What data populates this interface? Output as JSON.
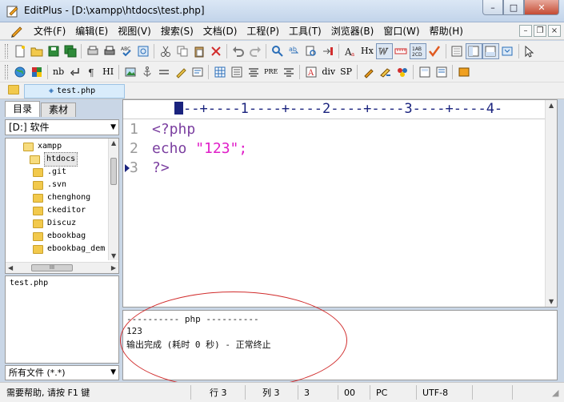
{
  "window": {
    "title": "EditPlus - [D:\\xampp\\htdocs\\test.php]",
    "buttons": {
      "minimize": "–",
      "maximize": "□",
      "close": "✕"
    }
  },
  "menu": [
    "文件(F)",
    "编辑(E)",
    "视图(V)",
    "搜索(S)",
    "文档(D)",
    "工程(P)",
    "工具(T)",
    "浏览器(B)",
    "窗口(W)",
    "帮助(H)"
  ],
  "mdi_buttons": {
    "minimize": "–",
    "restore": "❐",
    "close": "×"
  },
  "toolbar2_text": {
    "nb": "nb",
    "hi": "HI",
    "pre": "PRE",
    "div": "div",
    "sp": "SP",
    "hx": "Hx"
  },
  "file_tab": {
    "name": "test.php"
  },
  "left_panel": {
    "tabs": [
      "目录",
      "素材"
    ],
    "drive": "[D:] 软件",
    "tree": [
      {
        "name": "xampp",
        "level": 0,
        "open": true
      },
      {
        "name": "htdocs",
        "level": 1,
        "open": true,
        "selected": true
      },
      {
        "name": ".git",
        "level": 2
      },
      {
        "name": ".svn",
        "level": 2
      },
      {
        "name": "chenghong",
        "level": 2
      },
      {
        "name": "ckeditor",
        "level": 2
      },
      {
        "name": "Discuz",
        "level": 2
      },
      {
        "name": "ebookbag",
        "level": 2
      },
      {
        "name": "ebookbag_dem",
        "level": 2
      }
    ],
    "tree_hscroll_label": "III",
    "files": [
      "test.php"
    ],
    "filter": "所有文件 (*.*)"
  },
  "editor": {
    "ruler": "--+----1----+----2----+----3----+----4-",
    "lines": [
      {
        "number": "1",
        "tokens": [
          {
            "text": "<?php",
            "class": "kw"
          }
        ]
      },
      {
        "number": "2",
        "tokens": [
          {
            "text": "echo ",
            "class": "kw"
          },
          {
            "text": "\"123\"",
            "class": "str"
          },
          {
            "text": ";",
            "class": "str"
          }
        ]
      },
      {
        "number": "3",
        "tokens": [
          {
            "text": "?>",
            "class": "kw"
          }
        ]
      }
    ],
    "current_line": 3
  },
  "output": {
    "lines": [
      "---------- php ----------",
      "123",
      "输出完成 (耗时 0 秒) - 正常终止"
    ]
  },
  "status": {
    "help": "需要帮助, 请按 F1 键",
    "line": "行 3",
    "col": "列 3",
    "value": "3",
    "code": "00",
    "eol": "PC",
    "encoding": "UTF-8"
  },
  "colors": {
    "keyword": "#7b3fa0",
    "string": "#e01ec8",
    "ruler": "#1a237e",
    "annotation": "#d12d2d"
  }
}
